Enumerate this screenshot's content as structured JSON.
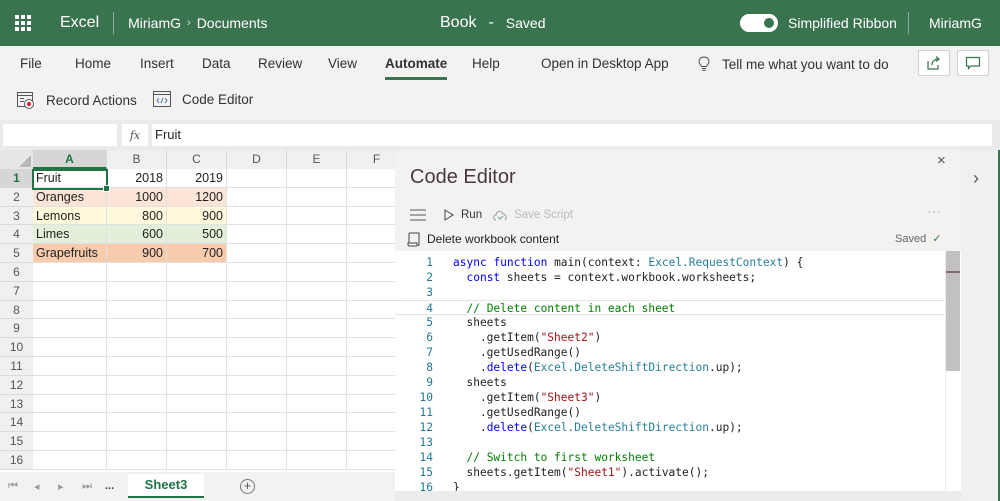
{
  "titlebar": {
    "app_name": "Excel",
    "breadcrumb_owner": "MiriamG",
    "breadcrumb_sep": "›",
    "breadcrumb_folder": "Documents",
    "doc_name": "Book",
    "doc_sep": "-",
    "doc_status": "Saved",
    "toggle_label": "Simplified Ribbon",
    "toggle_on": true,
    "user_name": "MiriamG"
  },
  "ribbon": {
    "tabs": [
      {
        "label": "File"
      },
      {
        "label": "Home"
      },
      {
        "label": "Insert"
      },
      {
        "label": "Data"
      },
      {
        "label": "Review"
      },
      {
        "label": "View"
      },
      {
        "label": "Automate",
        "active": true
      },
      {
        "label": "Help"
      },
      {
        "label": "Open in Desktop App"
      }
    ],
    "tell_me": "Tell me what you want to do",
    "commands": [
      {
        "label": "Record Actions",
        "icon": "record-actions-icon"
      },
      {
        "label": "Code Editor",
        "icon": "code-editor-icon"
      }
    ]
  },
  "formula_bar": {
    "name_box": "",
    "fx_label": "fx",
    "value": "Fruit"
  },
  "grid": {
    "columns": [
      "A",
      "B",
      "C",
      "D",
      "E",
      "F"
    ],
    "selected_column": "A",
    "rows": [
      "1",
      "2",
      "3",
      "4",
      "5",
      "6",
      "7",
      "8",
      "9",
      "10",
      "11",
      "12",
      "13",
      "14",
      "15",
      "16"
    ],
    "selected_row": "1",
    "cells": [
      {
        "row": 1,
        "values": [
          "Fruit",
          "2018",
          "2019"
        ],
        "color": "#ffffff"
      },
      {
        "row": 2,
        "values": [
          "Oranges",
          "1000",
          "1200"
        ],
        "color": "#fce4d6"
      },
      {
        "row": 3,
        "values": [
          "Lemons",
          "800",
          "900"
        ],
        "color": "#fff8dc"
      },
      {
        "row": 4,
        "values": [
          "Limes",
          "600",
          "500"
        ],
        "color": "#e2efda"
      },
      {
        "row": 5,
        "values": [
          "Grapefruits",
          "900",
          "700"
        ],
        "color": "#f8cbad"
      }
    ]
  },
  "sheets": {
    "overflow": "...",
    "active": "Sheet3",
    "add_label": "+"
  },
  "code_editor": {
    "title": "Code Editor",
    "close": "×",
    "run_label": "Run",
    "save_label": "Save Script",
    "more": "···",
    "script_name": "Delete workbook content",
    "saved_label": "Saved",
    "lines": [
      "1",
      "2",
      "3",
      "4",
      "5",
      "6",
      "7",
      "8",
      "9",
      "10",
      "11",
      "12",
      "13",
      "14",
      "15",
      "16"
    ],
    "code": [
      "async function main(context: Excel.RequestContext) {",
      "  const sheets = context.workbook.worksheets;",
      "",
      "  // Delete content in each sheet",
      "  sheets",
      "    .getItem(\"Sheet2\")",
      "    .getUsedRange()",
      "    .delete(Excel.DeleteShiftDirection.up);",
      "  sheets",
      "    .getItem(\"Sheet3\")",
      "    .getUsedRange()",
      "    .delete(Excel.DeleteShiftDirection.up);",
      "",
      "  // Switch to first worksheet",
      "  sheets.getItem(\"Sheet1\").activate();",
      "}"
    ]
  },
  "colors": {
    "brand": "#3a7350",
    "excel_green": "#217346"
  }
}
